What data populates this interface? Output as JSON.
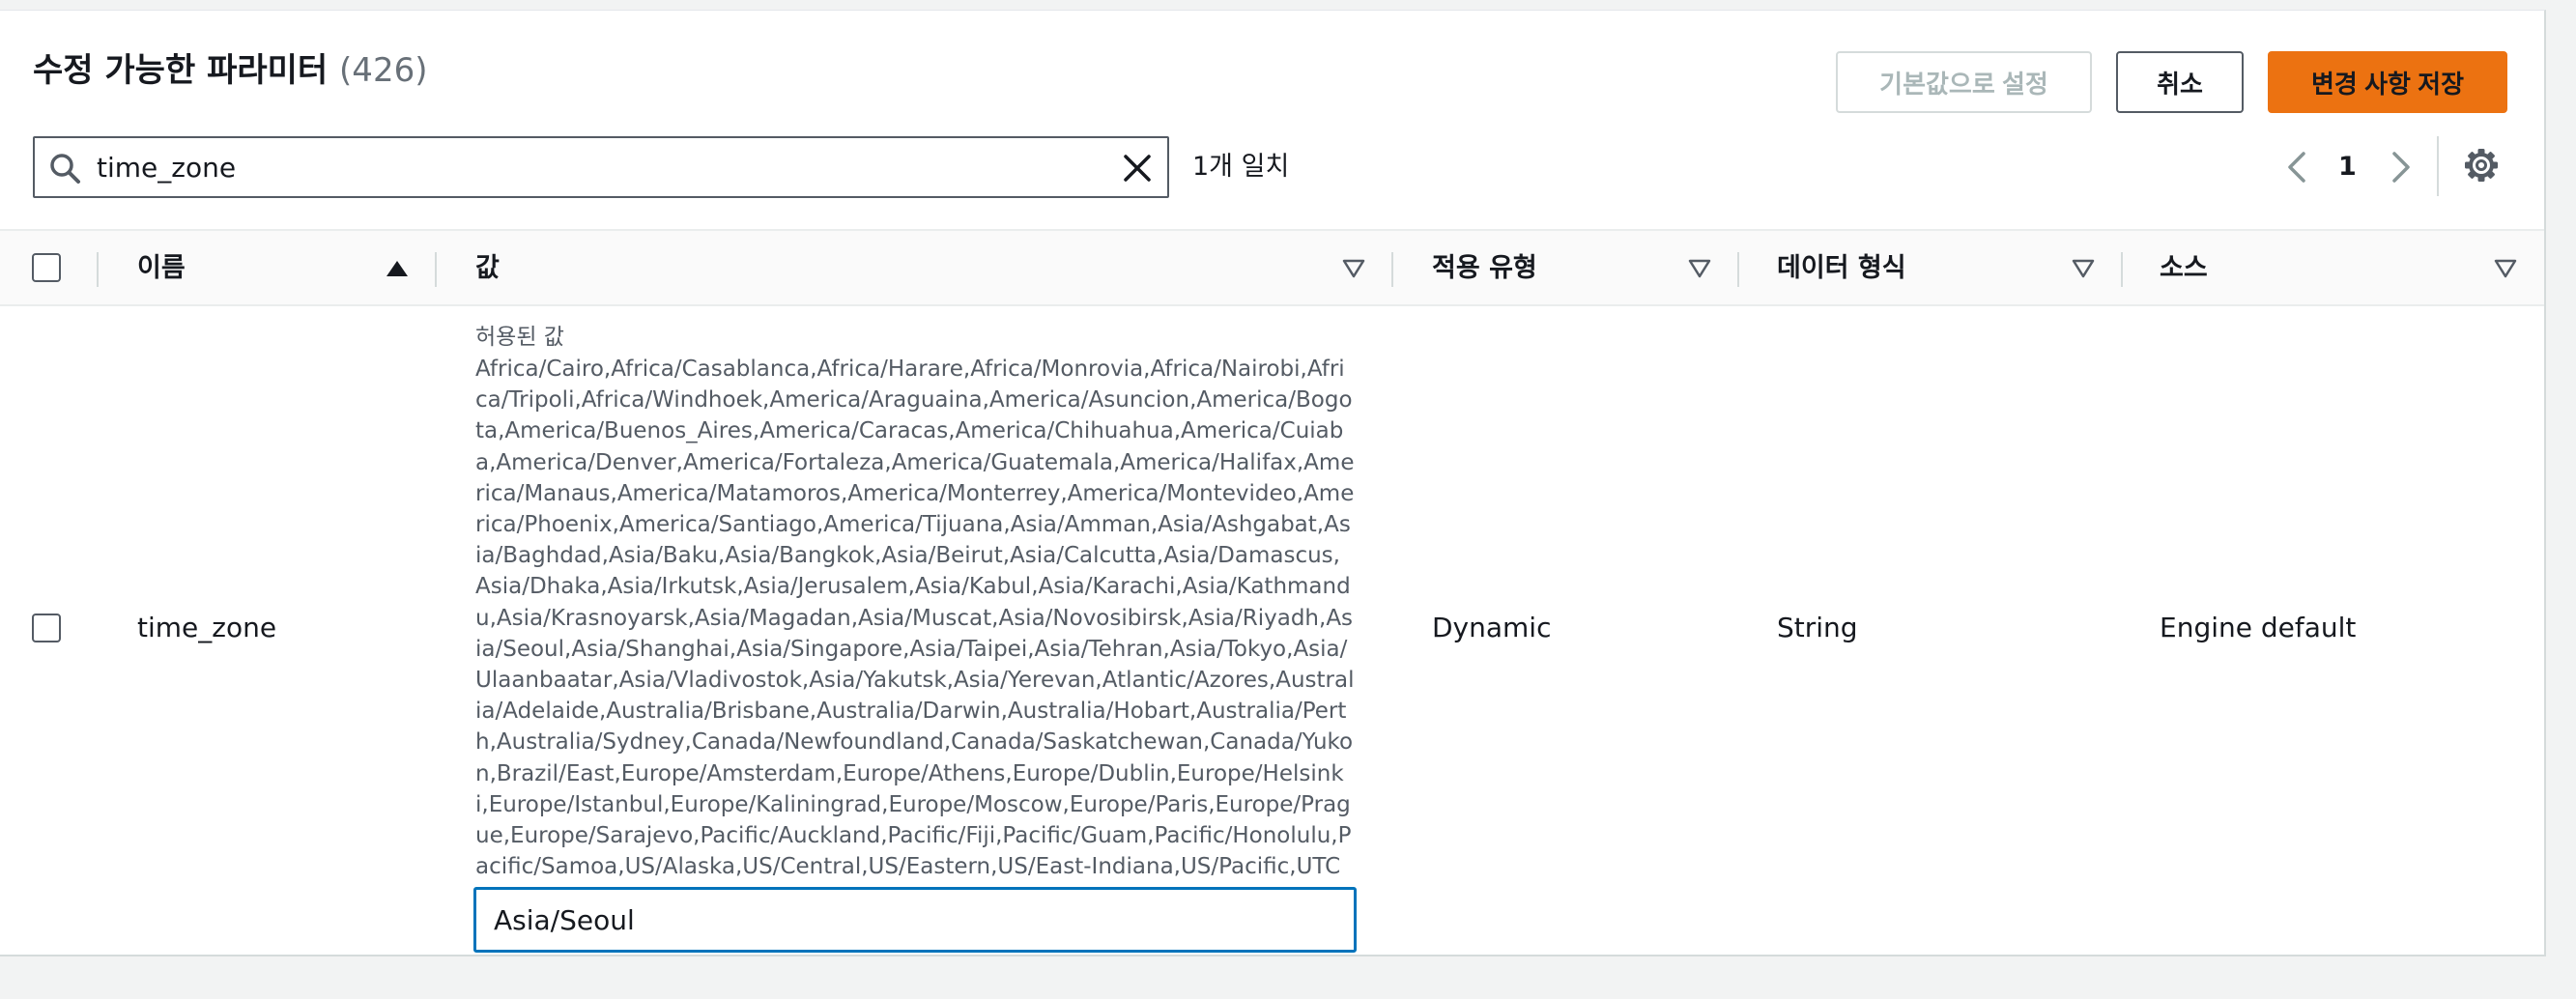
{
  "header": {
    "title": "수정 가능한 파라미터",
    "count": "(426)"
  },
  "actions": {
    "reset_label": "기본값으로 설정",
    "cancel_label": "취소",
    "save_label": "변경 사항 저장"
  },
  "search": {
    "value": "time_zone",
    "match_text": "1개 일치"
  },
  "pagination": {
    "current_page": "1"
  },
  "table": {
    "columns": [
      {
        "label": "이름",
        "sort": "ascending"
      },
      {
        "label": "값"
      },
      {
        "label": "적용 유형"
      },
      {
        "label": "데이터 형식"
      },
      {
        "label": "소스"
      }
    ],
    "rows": [
      {
        "name": "time_zone",
        "allowed_values_label": "허용된 값",
        "allowed_values": "Africa/Cairo,Africa/Casablanca,Africa/Harare,Africa/Monrovia,Africa/Nairobi,Africa/Tripoli,Africa/Windhoek,America/Araguaina,America/Asuncion,America/Bogota,America/Buenos_Aires,America/Caracas,America/Chihuahua,America/Cuiaba,America/Denver,America/Fortaleza,America/Guatemala,America/Halifax,America/Manaus,America/Matamoros,America/Monterrey,America/Montevideo,America/Phoenix,America/Santiago,America/Tijuana,Asia/Amman,Asia/Ashgabat,Asia/Baghdad,Asia/Baku,Asia/Bangkok,Asia/Beirut,Asia/Calcutta,Asia/Damascus,Asia/Dhaka,Asia/Irkutsk,Asia/Jerusalem,Asia/Kabul,Asia/Karachi,Asia/Kathmandu,Asia/Krasnoyarsk,Asia/Magadan,Asia/Muscat,Asia/Novosibirsk,Asia/Riyadh,Asia/Seoul,Asia/Shanghai,Asia/Singapore,Asia/Taipei,Asia/Tehran,Asia/Tokyo,Asia/Ulaanbaatar,Asia/Vladivostok,Asia/Yakutsk,Asia/Yerevan,Atlantic/Azores,Australia/Adelaide,Australia/Brisbane,Australia/Darwin,Australia/Hobart,Australia/Perth,Australia/Sydney,Canada/Newfoundland,Canada/Saskatchewan,Canada/Yukon,Brazil/East,Europe/Amsterdam,Europe/Athens,Europe/Dublin,Europe/Helsinki,Europe/Istanbul,Europe/Kaliningrad,Europe/Moscow,Europe/Paris,Europe/Prague,Europe/Sarajevo,Pacific/Auckland,Pacific/Fiji,Pacific/Guam,Pacific/Honolulu,Pacific/Samoa,US/Alaska,US/Central,US/Eastern,US/East-Indiana,US/Pacific,UTC",
        "value": "Asia/Seoul",
        "apply_type": "Dynamic",
        "data_type": "String",
        "source": "Engine default"
      }
    ]
  },
  "colors": {
    "primary": "#ec7211",
    "focus": "#0073bb",
    "text": "#16191f",
    "muted": "#687078"
  },
  "icons": {
    "search": "search-icon",
    "clear": "close-icon",
    "prev": "chevron-left-icon",
    "next": "chevron-right-icon",
    "settings": "gear-icon",
    "sort_asc": "caret-up-icon",
    "filter": "caret-down-icon"
  }
}
